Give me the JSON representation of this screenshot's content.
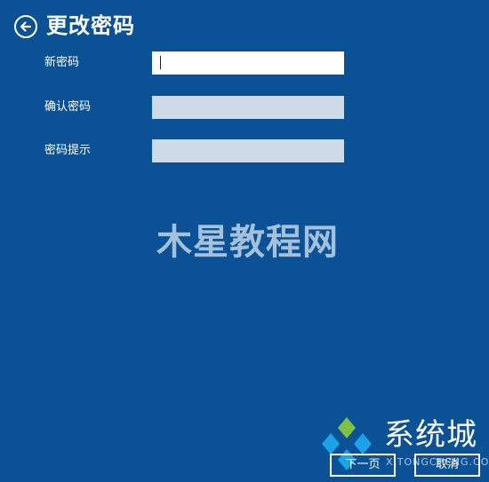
{
  "header": {
    "title": "更改密码",
    "back_icon": "arrow-left-circle-icon"
  },
  "form": {
    "fields": [
      {
        "label": "新密码",
        "value": "",
        "state": "focused"
      },
      {
        "label": "确认密码",
        "value": "",
        "state": "inactive"
      },
      {
        "label": "密码提示",
        "value": "",
        "state": "inactive"
      }
    ]
  },
  "footer": {
    "next_label": "下一页",
    "cancel_label": "取消"
  },
  "watermarks": {
    "center_text": "木星教程网",
    "brand_name": "系统城",
    "brand_sub": "XITONGCHENG.COM"
  },
  "colors": {
    "background": "#0b5196",
    "input_active": "#ffffff",
    "input_inactive": "#cddbe9",
    "text": "#ffffff",
    "logo_blue": "#1aa3e8",
    "logo_green": "#7dc242"
  }
}
